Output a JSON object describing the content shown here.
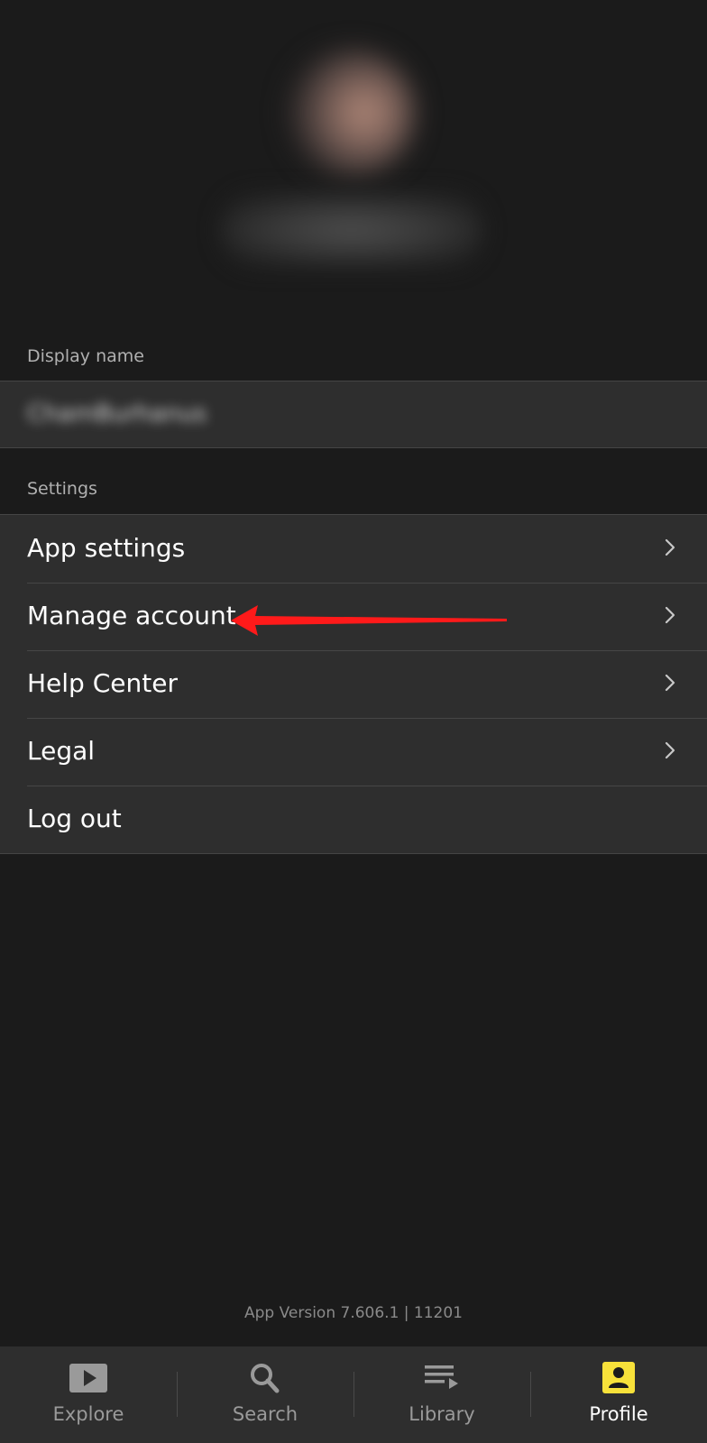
{
  "profile": {
    "display_name_label": "Display name",
    "display_name_value": "ChamBurhanus"
  },
  "settings": {
    "section_label": "Settings",
    "items": [
      {
        "label": "App settings",
        "has_chevron": true
      },
      {
        "label": "Manage account",
        "has_chevron": true
      },
      {
        "label": "Help Center",
        "has_chevron": true
      },
      {
        "label": "Legal",
        "has_chevron": true
      },
      {
        "label": "Log out",
        "has_chevron": false
      }
    ]
  },
  "app_version": "App Version 7.606.1 | 11201",
  "bottom_nav": {
    "tabs": [
      {
        "label": "Explore",
        "icon": "play-icon",
        "active": false
      },
      {
        "label": "Search",
        "icon": "search-icon",
        "active": false
      },
      {
        "label": "Library",
        "icon": "library-icon",
        "active": false
      },
      {
        "label": "Profile",
        "icon": "profile-icon",
        "active": true
      }
    ]
  },
  "colors": {
    "background": "#1b1b1b",
    "surface": "#2e2e2e",
    "accent": "#f7e13a",
    "annotation": "#ff1a1a"
  }
}
